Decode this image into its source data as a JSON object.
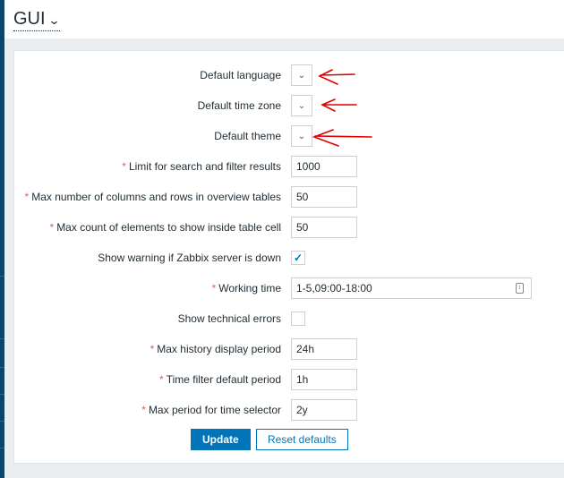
{
  "header": {
    "title": "GUI"
  },
  "form": {
    "rows": [
      {
        "label": "Default language",
        "type": "select",
        "required": false
      },
      {
        "label": "Default time zone",
        "type": "select",
        "required": false
      },
      {
        "label": "Default theme",
        "type": "select",
        "required": false
      },
      {
        "label": "Limit for search and filter results",
        "type": "text",
        "required": true,
        "value": "1000"
      },
      {
        "label": "Max number of columns and rows in overview tables",
        "type": "text",
        "required": true,
        "value": "50"
      },
      {
        "label": "Max count of elements to show inside table cell",
        "type": "text",
        "required": true,
        "value": "50"
      },
      {
        "label": "Show warning if Zabbix server is down",
        "type": "checkbox",
        "required": false,
        "checked": true
      },
      {
        "label": "Working time",
        "type": "text-wide",
        "required": true,
        "value": "1-5,09:00-18:00"
      },
      {
        "label": "Show technical errors",
        "type": "checkbox",
        "required": false,
        "checked": false
      },
      {
        "label": "Max history display period",
        "type": "text",
        "required": true,
        "value": "24h"
      },
      {
        "label": "Time filter default period",
        "type": "text",
        "required": true,
        "value": "1h"
      },
      {
        "label": "Max period for time selector",
        "type": "text",
        "required": true,
        "value": "2y"
      }
    ],
    "required_mark": "*",
    "update_label": "Update",
    "reset_label": "Reset defaults"
  },
  "colors": {
    "accent": "#0275b8",
    "required": "#e45959",
    "annotation": "#e00000"
  }
}
